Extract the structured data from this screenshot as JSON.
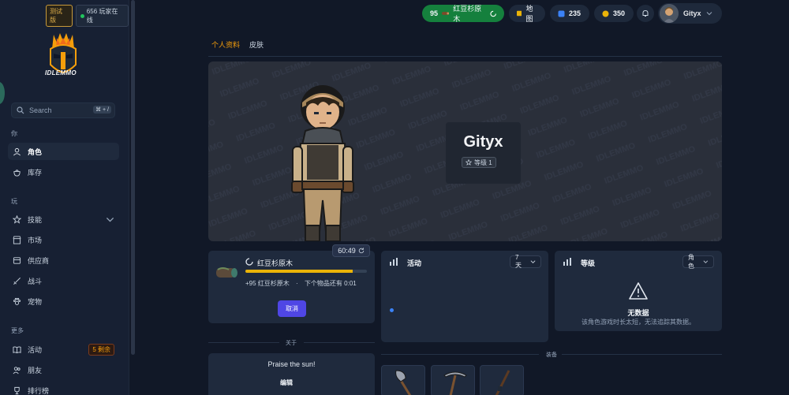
{
  "sidebar": {
    "beta_badge": "测试版",
    "online_count": "656 玩家在线",
    "logo_text": "IDLEMMO",
    "search": {
      "placeholder": "Search",
      "shortcut": "⌘ + /"
    },
    "sections": [
      {
        "label": "你"
      },
      {
        "label": "玩"
      },
      {
        "label": "更多"
      }
    ],
    "items": [
      {
        "label": "角色",
        "icon": "user-icon",
        "active": true
      },
      {
        "label": "库存",
        "icon": "bag-icon"
      },
      {
        "label": "技能",
        "icon": "star-icon"
      },
      {
        "label": "市场",
        "icon": "store-icon"
      },
      {
        "label": "供应商",
        "icon": "vendor-icon"
      },
      {
        "label": "战斗",
        "icon": "sword-icon"
      },
      {
        "label": "宠物",
        "icon": "paw-icon"
      },
      {
        "label": "活动",
        "icon": "book-icon",
        "badge": "5 剩余"
      },
      {
        "label": "朋友",
        "icon": "friends-icon"
      },
      {
        "label": "排行榜",
        "icon": "trophy-icon"
      }
    ]
  },
  "topbar": {
    "activity_pill": {
      "count": "95",
      "label": "红豆杉原木"
    },
    "map": "地图",
    "gems": "235",
    "gold": "350",
    "username": "Gityx"
  },
  "tabs": [
    {
      "label": "个人资料",
      "active": true
    },
    {
      "label": "皮肤"
    }
  ],
  "profile": {
    "name": "Gityx",
    "level": "等级 1"
  },
  "activity_card": {
    "timer": "60:49",
    "title": "红豆杉原木",
    "progress": 0.88,
    "gain": "+95 红豆杉原木",
    "next": "下个物品还有 0:01",
    "cancel": "取消"
  },
  "activity_panel": {
    "title": "活动",
    "range": "7 天"
  },
  "level_panel": {
    "title": "等级",
    "filter": "角色",
    "nodata_title": "无数据",
    "nodata_desc": "该角色游戏时长太短，无法追踪其数据。"
  },
  "about": {
    "label": "关于",
    "text": "Praise the sun!",
    "edit": "编辑"
  },
  "equipment": {
    "label": "装备",
    "slots": [
      "axe-icon",
      "pickaxe-icon",
      "rod-icon"
    ]
  },
  "colors": {
    "accent": "#f59e0b",
    "primary_button": "#4f46e5",
    "progress": "#eab308",
    "online": "#22c55e",
    "activity_pill": "#15803d"
  }
}
